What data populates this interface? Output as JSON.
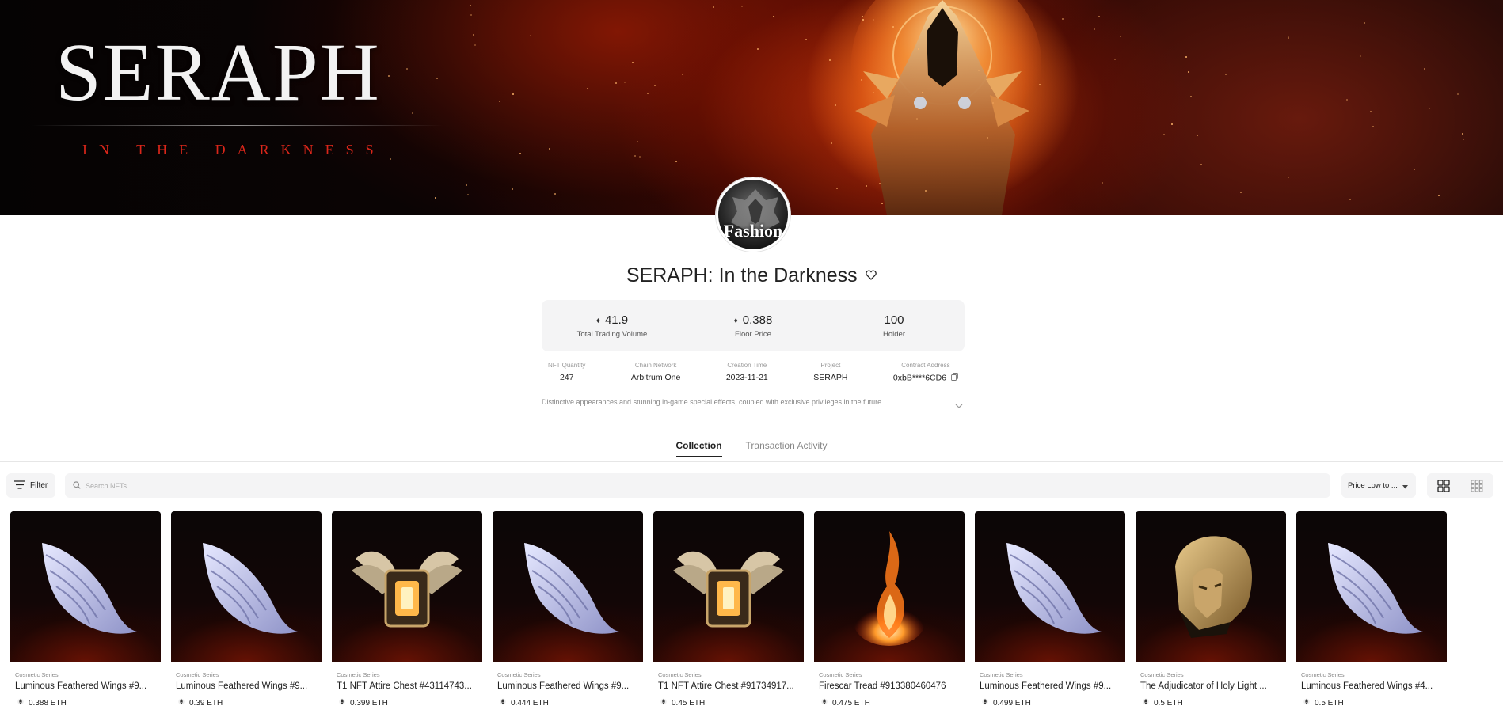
{
  "banner": {
    "logo_title": "SERAPH",
    "logo_subtitle": "IN THE DARKNESS"
  },
  "avatar": {
    "text": "Fashion"
  },
  "collection": {
    "title": "SERAPH: In the Darkness",
    "stats": [
      {
        "value": "41.9",
        "label": "Total Trading Volume",
        "icon": "eth-icon"
      },
      {
        "value": "0.388",
        "label": "Floor Price",
        "icon": "eth-icon"
      },
      {
        "value": "100",
        "label": "Holder"
      }
    ],
    "meta": [
      {
        "label": "NFT Quantity",
        "value": "247"
      },
      {
        "label": "Chain Network",
        "value": "Arbitrum One"
      },
      {
        "label": "Creation Time",
        "value": "2023-11-21"
      },
      {
        "label": "Project",
        "value": "SERAPH"
      },
      {
        "label": "Contract Address",
        "value": "0xbB****6CD6"
      }
    ],
    "description": "Distinctive appearances and stunning in-game special effects, coupled with exclusive privileges in the future."
  },
  "tabs": [
    {
      "label": "Collection",
      "active": true
    },
    {
      "label": "Transaction Activity",
      "active": false
    }
  ],
  "toolbar": {
    "filter_label": "Filter",
    "search_placeholder": "Search NFTs",
    "sort_label": "Price Low to ..."
  },
  "cards": [
    {
      "series": "Cosmetic Series",
      "name": "Luminous Feathered Wings #9...",
      "price": "0.388 ETH",
      "art": "wings"
    },
    {
      "series": "Cosmetic Series",
      "name": "Luminous Feathered Wings #9...",
      "price": "0.39 ETH",
      "art": "wings"
    },
    {
      "series": "Cosmetic Series",
      "name": "T1 NFT Attire Chest #43114743...",
      "price": "0.399 ETH",
      "art": "chest"
    },
    {
      "series": "Cosmetic Series",
      "name": "Luminous Feathered Wings #9...",
      "price": "0.444 ETH",
      "art": "wings"
    },
    {
      "series": "Cosmetic Series",
      "name": "T1 NFT Attire Chest #91734917...",
      "price": "0.45 ETH",
      "art": "chest"
    },
    {
      "series": "Cosmetic Series",
      "name": "Firescar Tread #913380460476",
      "price": "0.475 ETH",
      "art": "fire"
    },
    {
      "series": "Cosmetic Series",
      "name": "Luminous Feathered Wings #9...",
      "price": "0.499 ETH",
      "art": "wings"
    },
    {
      "series": "Cosmetic Series",
      "name": "The Adjudicator of Holy Light ...",
      "price": "0.5 ETH",
      "art": "helmet"
    },
    {
      "series": "Cosmetic Series",
      "name": "Luminous Feathered Wings #4...",
      "price": "0.5 ETH",
      "art": "wings"
    }
  ],
  "colors": {
    "accent_red": "#d9261a",
    "panel_bg": "#f4f4f5",
    "text_dark": "#222222"
  }
}
